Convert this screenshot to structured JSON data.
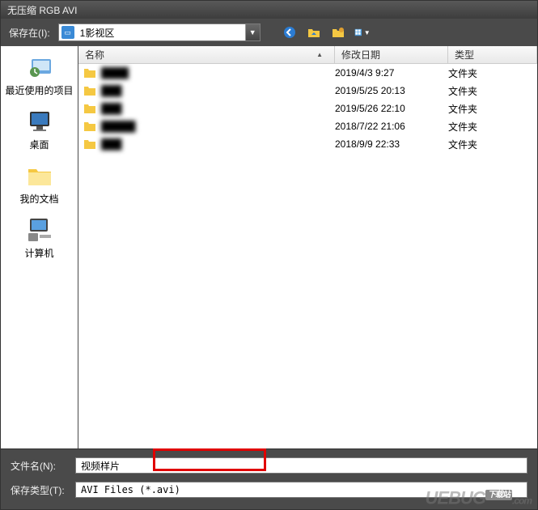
{
  "title": "无压缩 RGB AVI",
  "toolbar": {
    "save_in_label": "保存在(I):",
    "location": "1影视区"
  },
  "sidebar": {
    "items": [
      {
        "label": "最近使用的项目"
      },
      {
        "label": "桌面"
      },
      {
        "label": "我的文档"
      },
      {
        "label": "计算机"
      }
    ]
  },
  "columns": {
    "name": "名称",
    "date": "修改日期",
    "type": "类型"
  },
  "files": [
    {
      "name": "████",
      "date": "2019/4/3 9:27",
      "type": "文件夹"
    },
    {
      "name": "███",
      "date": "2019/5/25 20:13",
      "type": "文件夹"
    },
    {
      "name": "███",
      "date": "2019/5/26 22:10",
      "type": "文件夹"
    },
    {
      "name": "█████",
      "date": "2018/7/22 21:06",
      "type": "文件夹"
    },
    {
      "name": "███",
      "date": "2018/9/9 22:33",
      "type": "文件夹"
    }
  ],
  "bottom": {
    "filename_label": "文件名(N):",
    "filename_value": "视频样片",
    "filetype_label": "保存类型(T):",
    "filetype_value": "AVI Files (*.avi)"
  },
  "watermark": "UEBUG",
  "watermark_suffix": ".com",
  "watermark_tag": "下载站"
}
